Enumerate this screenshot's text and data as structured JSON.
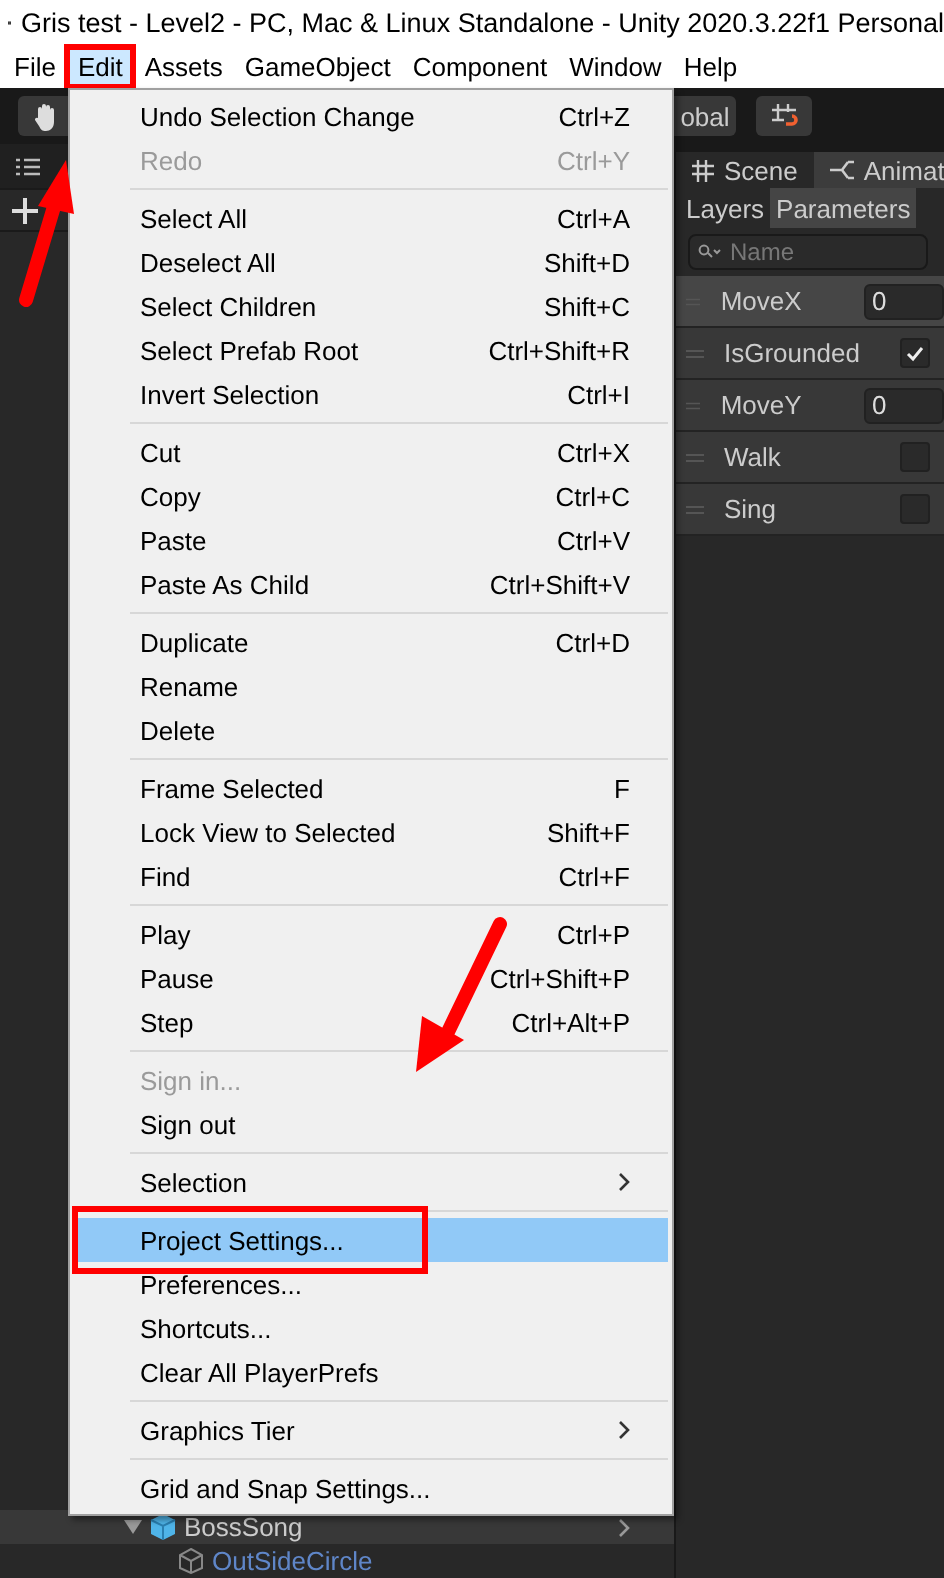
{
  "window": {
    "title": "Gris test - Level2 - PC, Mac & Linux Standalone - Unity 2020.3.22f1 Personal"
  },
  "menubar": [
    {
      "label": "File",
      "selected": false,
      "annotated": false
    },
    {
      "label": "Edit",
      "selected": true,
      "annotated": true
    },
    {
      "label": "Assets",
      "selected": false,
      "annotated": false
    },
    {
      "label": "GameObject",
      "selected": false,
      "annotated": false
    },
    {
      "label": "Component",
      "selected": false,
      "annotated": false
    },
    {
      "label": "Window",
      "selected": false,
      "annotated": false
    },
    {
      "label": "Help",
      "selected": false,
      "annotated": false
    }
  ],
  "menubar_arrow": true,
  "toolbar": {
    "global_button": "obal"
  },
  "edit_menu": [
    [
      {
        "label": "Undo Selection Change",
        "shortcut": "Ctrl+Z",
        "disabled": false,
        "selected": false,
        "submenu": false,
        "annotated": false
      },
      {
        "label": "Redo",
        "shortcut": "Ctrl+Y",
        "disabled": true,
        "selected": false,
        "submenu": false,
        "annotated": false
      }
    ],
    [
      {
        "label": "Select All",
        "shortcut": "Ctrl+A",
        "disabled": false,
        "selected": false,
        "submenu": false,
        "annotated": false
      },
      {
        "label": "Deselect All",
        "shortcut": "Shift+D",
        "disabled": false,
        "selected": false,
        "submenu": false,
        "annotated": false
      },
      {
        "label": "Select Children",
        "shortcut": "Shift+C",
        "disabled": false,
        "selected": false,
        "submenu": false,
        "annotated": false
      },
      {
        "label": "Select Prefab Root",
        "shortcut": "Ctrl+Shift+R",
        "disabled": false,
        "selected": false,
        "submenu": false,
        "annotated": false
      },
      {
        "label": "Invert Selection",
        "shortcut": "Ctrl+I",
        "disabled": false,
        "selected": false,
        "submenu": false,
        "annotated": false
      }
    ],
    [
      {
        "label": "Cut",
        "shortcut": "Ctrl+X",
        "disabled": false,
        "selected": false,
        "submenu": false,
        "annotated": false
      },
      {
        "label": "Copy",
        "shortcut": "Ctrl+C",
        "disabled": false,
        "selected": false,
        "submenu": false,
        "annotated": false
      },
      {
        "label": "Paste",
        "shortcut": "Ctrl+V",
        "disabled": false,
        "selected": false,
        "submenu": false,
        "annotated": false
      },
      {
        "label": "Paste As Child",
        "shortcut": "Ctrl+Shift+V",
        "disabled": false,
        "selected": false,
        "submenu": false,
        "annotated": false
      }
    ],
    [
      {
        "label": "Duplicate",
        "shortcut": "Ctrl+D",
        "disabled": false,
        "selected": false,
        "submenu": false,
        "annotated": false
      },
      {
        "label": "Rename",
        "disabled": false,
        "selected": false,
        "submenu": false,
        "annotated": false
      },
      {
        "label": "Delete",
        "disabled": false,
        "selected": false,
        "submenu": false,
        "annotated": false
      }
    ],
    [
      {
        "label": "Frame Selected",
        "shortcut": "F",
        "disabled": false,
        "selected": false,
        "submenu": false,
        "annotated": false
      },
      {
        "label": "Lock View to Selected",
        "shortcut": "Shift+F",
        "disabled": false,
        "selected": false,
        "submenu": false,
        "annotated": false
      },
      {
        "label": "Find",
        "shortcut": "Ctrl+F",
        "disabled": false,
        "selected": false,
        "submenu": false,
        "annotated": false
      }
    ],
    [
      {
        "label": "Play",
        "shortcut": "Ctrl+P",
        "disabled": false,
        "selected": false,
        "submenu": false,
        "annotated": false
      },
      {
        "label": "Pause",
        "shortcut": "Ctrl+Shift+P",
        "disabled": false,
        "selected": false,
        "submenu": false,
        "annotated": false
      },
      {
        "label": "Step",
        "shortcut": "Ctrl+Alt+P",
        "disabled": false,
        "selected": false,
        "submenu": false,
        "annotated": false
      }
    ],
    [
      {
        "label": "Sign in...",
        "disabled": true,
        "selected": false,
        "submenu": false,
        "annotated": false
      },
      {
        "label": "Sign out",
        "disabled": false,
        "selected": false,
        "submenu": false,
        "annotated": false
      }
    ],
    [
      {
        "label": "Selection",
        "disabled": false,
        "selected": false,
        "submenu": true,
        "annotated": false
      }
    ],
    [
      {
        "label": "Project Settings...",
        "disabled": false,
        "selected": true,
        "submenu": false,
        "annotated": true,
        "arrow": true
      },
      {
        "label": "Preferences...",
        "disabled": false,
        "selected": false,
        "submenu": false,
        "annotated": false
      },
      {
        "label": "Shortcuts...",
        "disabled": false,
        "selected": false,
        "submenu": false,
        "annotated": false
      },
      {
        "label": "Clear All PlayerPrefs",
        "disabled": false,
        "selected": false,
        "submenu": false,
        "annotated": false
      }
    ],
    [
      {
        "label": "Graphics Tier",
        "disabled": false,
        "selected": false,
        "submenu": true,
        "annotated": false
      }
    ],
    [
      {
        "label": "Grid and Snap Settings...",
        "disabled": false,
        "selected": false,
        "submenu": false,
        "annotated": false
      }
    ]
  ],
  "animator": {
    "tabs": [
      {
        "label": "Scene",
        "selected": false
      },
      {
        "label": "Animat",
        "selected": true
      }
    ],
    "subtabs": [
      {
        "label": "Layers",
        "selected": false
      },
      {
        "label": "Parameters",
        "selected": true
      }
    ],
    "search": {
      "placeholder": "Name"
    },
    "parameters": [
      {
        "name": "MoveX",
        "kind": "float",
        "value": "0",
        "selected": true
      },
      {
        "name": "IsGrounded",
        "kind": "bool",
        "checked": true,
        "selected": false
      },
      {
        "name": "MoveY",
        "kind": "float",
        "value": "0",
        "selected": false
      },
      {
        "name": "Walk",
        "kind": "trigger",
        "checked": false,
        "selected": false
      },
      {
        "name": "Sing",
        "kind": "trigger",
        "checked": false,
        "selected": false
      }
    ]
  },
  "hierarchy": {
    "rows": [
      {
        "name": "BossSong",
        "kind": "prefab",
        "expanded": true,
        "selected": false
      },
      {
        "name": "OutSideCircle",
        "kind": "object",
        "expanded": false,
        "selected": false
      }
    ]
  }
}
